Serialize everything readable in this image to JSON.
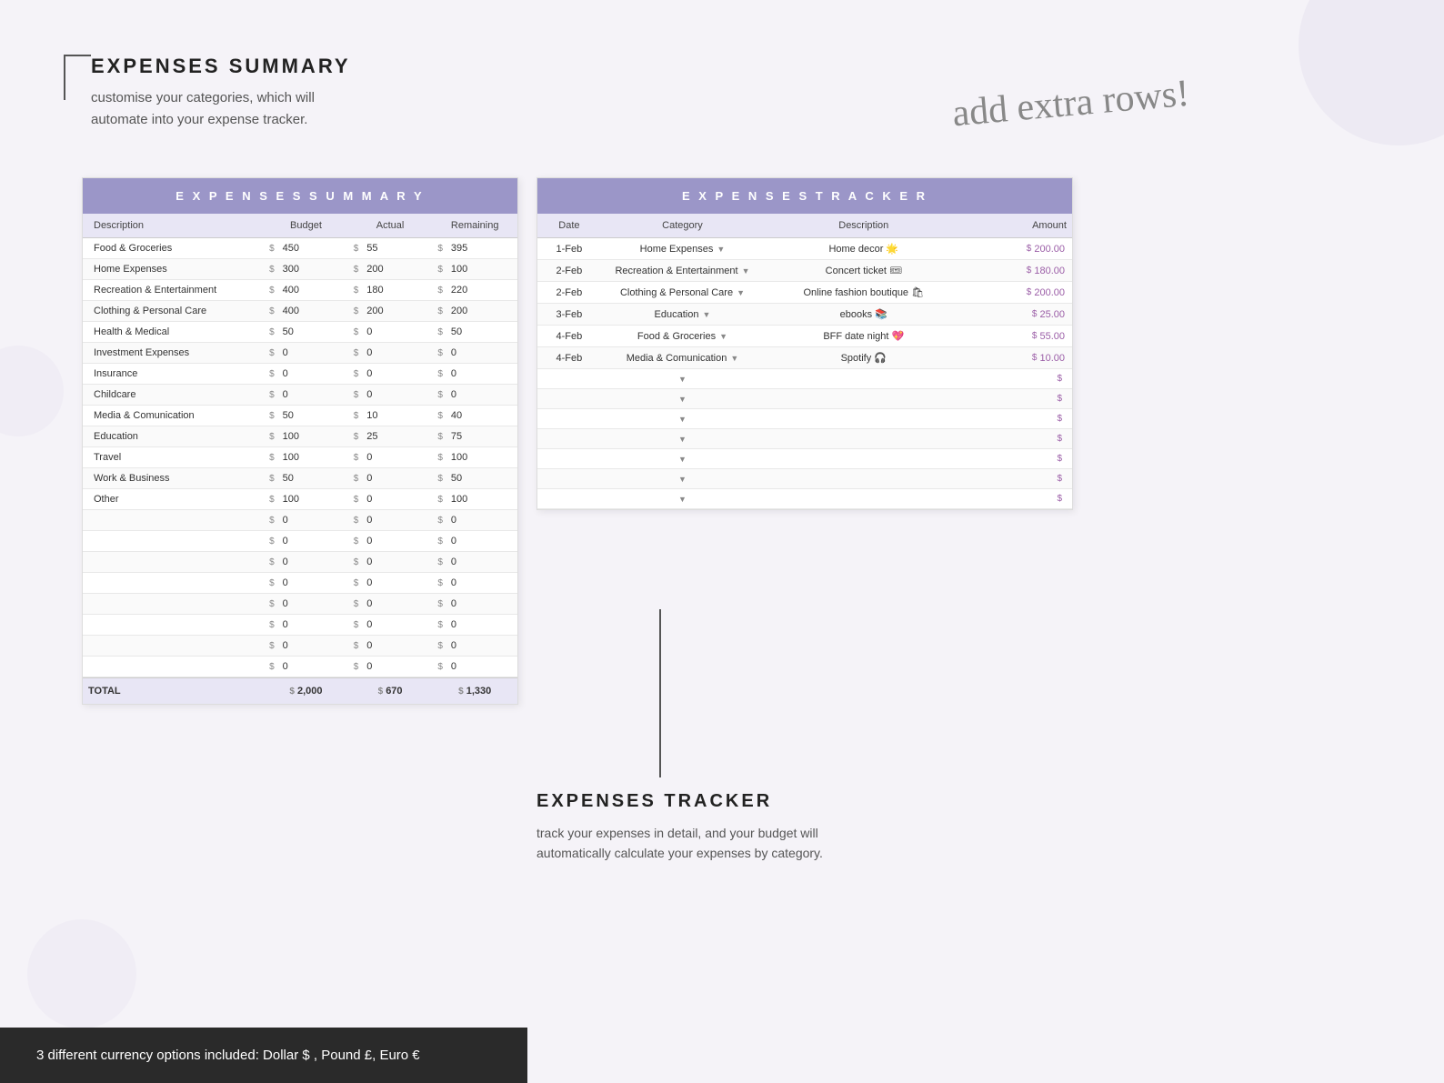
{
  "header": {
    "title": "EXPENSES SUMMARY",
    "subtitle_line1": "customise your categories, which will",
    "subtitle_line2": "automate into your expense tracker."
  },
  "handwriting": "add extra rows!",
  "summary_table": {
    "title": "E X P E N S E S   S U M M A R Y",
    "columns": [
      "Description",
      "Budget",
      "Actual",
      "Remaining"
    ],
    "rows": [
      {
        "desc": "Food & Groceries",
        "budget": "450",
        "actual": "55",
        "remaining": "395"
      },
      {
        "desc": "Home Expenses",
        "budget": "300",
        "actual": "200",
        "remaining": "100"
      },
      {
        "desc": "Recreation & Entertainment",
        "budget": "400",
        "actual": "180",
        "remaining": "220"
      },
      {
        "desc": "Clothing & Personal Care",
        "budget": "400",
        "actual": "200",
        "remaining": "200"
      },
      {
        "desc": "Health & Medical",
        "budget": "50",
        "actual": "0",
        "remaining": "50"
      },
      {
        "desc": "Investment Expenses",
        "budget": "0",
        "actual": "0",
        "remaining": "0"
      },
      {
        "desc": "Insurance",
        "budget": "0",
        "actual": "0",
        "remaining": "0"
      },
      {
        "desc": "Childcare",
        "budget": "0",
        "actual": "0",
        "remaining": "0"
      },
      {
        "desc": "Media & Comunication",
        "budget": "50",
        "actual": "10",
        "remaining": "40"
      },
      {
        "desc": "Education",
        "budget": "100",
        "actual": "25",
        "remaining": "75"
      },
      {
        "desc": "Travel",
        "budget": "100",
        "actual": "0",
        "remaining": "100"
      },
      {
        "desc": "Work & Business",
        "budget": "50",
        "actual": "0",
        "remaining": "50"
      },
      {
        "desc": "Other",
        "budget": "100",
        "actual": "0",
        "remaining": "100"
      },
      {
        "desc": "",
        "budget": "0",
        "actual": "0",
        "remaining": "0"
      },
      {
        "desc": "",
        "budget": "0",
        "actual": "0",
        "remaining": "0"
      },
      {
        "desc": "",
        "budget": "0",
        "actual": "0",
        "remaining": "0"
      },
      {
        "desc": "",
        "budget": "0",
        "actual": "0",
        "remaining": "0"
      },
      {
        "desc": "",
        "budget": "0",
        "actual": "0",
        "remaining": "0"
      },
      {
        "desc": "",
        "budget": "0",
        "actual": "0",
        "remaining": "0"
      },
      {
        "desc": "",
        "budget": "0",
        "actual": "0",
        "remaining": "0"
      },
      {
        "desc": "",
        "budget": "0",
        "actual": "0",
        "remaining": "0"
      }
    ],
    "total": {
      "label": "TOTAL",
      "budget": "2,000",
      "actual": "670",
      "remaining": "1,330"
    }
  },
  "tracker_table": {
    "title": "E X P E N S E S   T R A C K E R",
    "columns": [
      "Date",
      "Category",
      "Description",
      "Amount"
    ],
    "rows": [
      {
        "date": "1-Feb",
        "category": "Home Expenses",
        "description": "Home decor 🌟",
        "amount": "200.00"
      },
      {
        "date": "2-Feb",
        "category": "Recreation & Entertainment",
        "description": "Concert ticket 🎟",
        "amount": "180.00"
      },
      {
        "date": "2-Feb",
        "category": "Clothing & Personal Care",
        "description": "Online fashion boutique 🛍",
        "amount": "200.00"
      },
      {
        "date": "3-Feb",
        "category": "Education",
        "description": "ebooks 📚",
        "amount": "25.00"
      },
      {
        "date": "4-Feb",
        "category": "Food & Groceries",
        "description": "BFF date night 💖",
        "amount": "55.00"
      },
      {
        "date": "4-Feb",
        "category": "Media & Comunication",
        "description": "Spotify 🎧",
        "amount": "10.00"
      },
      {
        "date": "",
        "category": "",
        "description": "",
        "amount": ""
      },
      {
        "date": "",
        "category": "",
        "description": "",
        "amount": ""
      },
      {
        "date": "",
        "category": "",
        "description": "",
        "amount": ""
      },
      {
        "date": "",
        "category": "",
        "description": "",
        "amount": ""
      },
      {
        "date": "",
        "category": "",
        "description": "",
        "amount": ""
      },
      {
        "date": "",
        "category": "",
        "description": "",
        "amount": ""
      },
      {
        "date": "",
        "category": "",
        "description": "",
        "amount": ""
      }
    ]
  },
  "bottom_bar": {
    "text": "3 different currency options included: Dollar $ , Pound £, Euro €"
  },
  "tracker_bottom": {
    "title": "EXPENSES TRACKER",
    "description_line1": "track your expenses in detail, and your budget will",
    "description_line2": "automatically calculate your expenses by category."
  }
}
